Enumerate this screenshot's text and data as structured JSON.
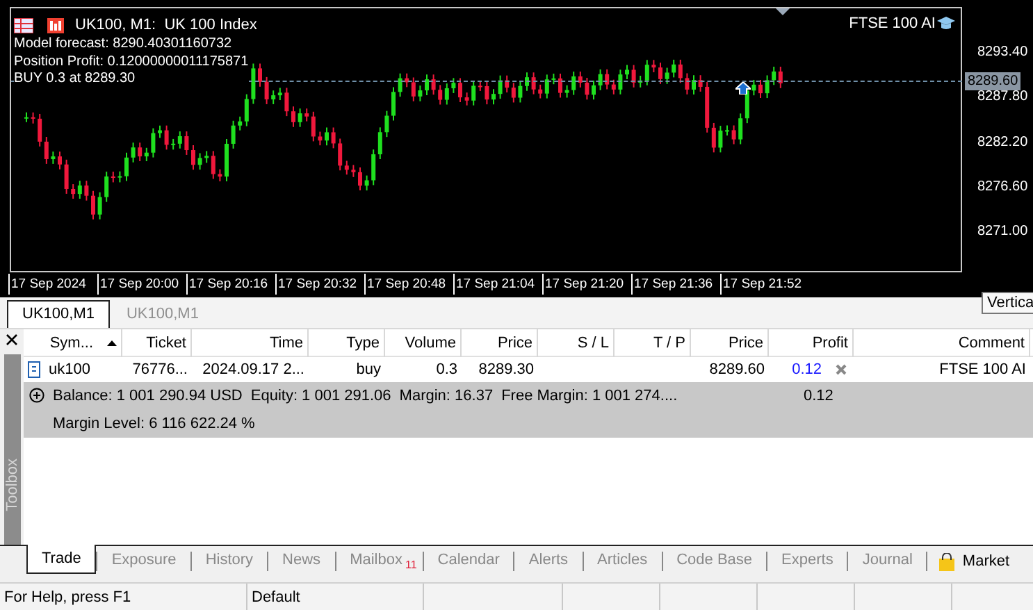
{
  "chart": {
    "title": "UK100, M1:  UK 100 Index",
    "info_lines": [
      "Model forecast: 8290.40301160732",
      "Position Profit: 0.12000000011175871",
      "BUY 0.3 at 8289.30"
    ],
    "expert_name": "FTSE 100 AI",
    "price_ticks": [
      "8293.40",
      "8287.80",
      "8282.20",
      "8276.60",
      "8271.00"
    ],
    "current_price": "8289.60",
    "time_ticks": [
      "17 Sep 2024",
      "17 Sep 20:00",
      "17 Sep 20:16",
      "17 Sep 20:32",
      "17 Sep 20:48",
      "17 Sep 21:04",
      "17 Sep 21:20",
      "17 Sep 21:36",
      "17 Sep 21:52"
    ]
  },
  "tooltip": "Vertica",
  "chart_tabs": [
    {
      "label": "UK100,M1",
      "selected": true
    },
    {
      "label": "UK100,M1",
      "selected": false
    }
  ],
  "toolbox": {
    "title": "Toolbox"
  },
  "table": {
    "columns": [
      {
        "label": "Sym...",
        "sorted": true
      },
      {
        "label": "Ticket",
        "sorted": false
      },
      {
        "label": "Time",
        "sorted": false
      },
      {
        "label": "Type",
        "sorted": false
      },
      {
        "label": "Volume",
        "sorted": false
      },
      {
        "label": "Price",
        "sorted": false
      },
      {
        "label": "S / L",
        "sorted": false
      },
      {
        "label": "T / P",
        "sorted": false
      },
      {
        "label": "Price",
        "sorted": false
      },
      {
        "label": "Profit",
        "sorted": false
      },
      {
        "label": "Comment",
        "sorted": false
      }
    ],
    "rows": [
      {
        "cells": [
          "uk100",
          "76776...",
          "2024.09.17 2...",
          "buy",
          "0.3",
          "8289.30",
          null,
          null,
          "8289.60",
          "0.12",
          "FTSE 100 AI"
        ]
      }
    ],
    "summary": {
      "parts": [
        "Balance: 1 001 290.94 USD",
        "Equity: 1 001 291.06",
        "Margin: 16.37",
        "Free Margin: 1 001 274...."
      ],
      "profit": "0.12",
      "margin_level": "Margin Level: 6 116 622.24 %"
    }
  },
  "bottom_tabs": [
    {
      "label": "Trade",
      "selected": true,
      "kind": "tab"
    },
    {
      "label": "Exposure",
      "selected": false,
      "kind": "tab"
    },
    {
      "label": "History",
      "selected": false,
      "kind": "tab"
    },
    {
      "label": "News",
      "selected": false,
      "kind": "tab"
    },
    {
      "label": "Mailbox",
      "selected": false,
      "kind": "tab",
      "badge": "11"
    },
    {
      "label": "Calendar",
      "selected": false,
      "kind": "tab"
    },
    {
      "label": "Alerts",
      "selected": false,
      "kind": "tab"
    },
    {
      "label": "Articles",
      "selected": false,
      "kind": "tab"
    },
    {
      "label": "Code Base",
      "selected": false,
      "kind": "tab"
    },
    {
      "label": "Experts",
      "selected": false,
      "kind": "tab"
    },
    {
      "label": "Journal",
      "selected": false,
      "kind": "tab"
    },
    {
      "label": "Market",
      "selected": false,
      "kind": "store"
    }
  ],
  "status_bar": [
    "For Help, press F1",
    "Default"
  ]
}
